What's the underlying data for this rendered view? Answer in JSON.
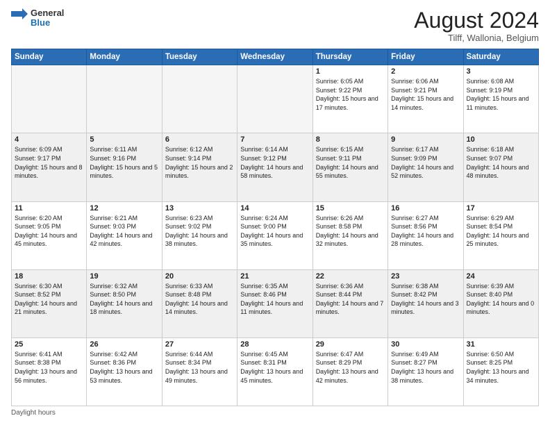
{
  "header": {
    "logo_general": "General",
    "logo_blue": "Blue",
    "month_title": "August 2024",
    "location": "Tilff, Wallonia, Belgium"
  },
  "days_of_week": [
    "Sunday",
    "Monday",
    "Tuesday",
    "Wednesday",
    "Thursday",
    "Friday",
    "Saturday"
  ],
  "footer": {
    "daylight_label": "Daylight hours"
  },
  "weeks": [
    [
      {
        "day": "",
        "empty": true
      },
      {
        "day": "",
        "empty": true
      },
      {
        "day": "",
        "empty": true
      },
      {
        "day": "",
        "empty": true
      },
      {
        "day": "1",
        "sunrise": "6:05 AM",
        "sunset": "9:22 PM",
        "daylight": "15 hours and 17 minutes."
      },
      {
        "day": "2",
        "sunrise": "6:06 AM",
        "sunset": "9:21 PM",
        "daylight": "15 hours and 14 minutes."
      },
      {
        "day": "3",
        "sunrise": "6:08 AM",
        "sunset": "9:19 PM",
        "daylight": "15 hours and 11 minutes."
      }
    ],
    [
      {
        "day": "4",
        "sunrise": "6:09 AM",
        "sunset": "9:17 PM",
        "daylight": "15 hours and 8 minutes."
      },
      {
        "day": "5",
        "sunrise": "6:11 AM",
        "sunset": "9:16 PM",
        "daylight": "15 hours and 5 minutes."
      },
      {
        "day": "6",
        "sunrise": "6:12 AM",
        "sunset": "9:14 PM",
        "daylight": "15 hours and 2 minutes."
      },
      {
        "day": "7",
        "sunrise": "6:14 AM",
        "sunset": "9:12 PM",
        "daylight": "14 hours and 58 minutes."
      },
      {
        "day": "8",
        "sunrise": "6:15 AM",
        "sunset": "9:11 PM",
        "daylight": "14 hours and 55 minutes."
      },
      {
        "day": "9",
        "sunrise": "6:17 AM",
        "sunset": "9:09 PM",
        "daylight": "14 hours and 52 minutes."
      },
      {
        "day": "10",
        "sunrise": "6:18 AM",
        "sunset": "9:07 PM",
        "daylight": "14 hours and 48 minutes."
      }
    ],
    [
      {
        "day": "11",
        "sunrise": "6:20 AM",
        "sunset": "9:05 PM",
        "daylight": "14 hours and 45 minutes."
      },
      {
        "day": "12",
        "sunrise": "6:21 AM",
        "sunset": "9:03 PM",
        "daylight": "14 hours and 42 minutes."
      },
      {
        "day": "13",
        "sunrise": "6:23 AM",
        "sunset": "9:02 PM",
        "daylight": "14 hours and 38 minutes."
      },
      {
        "day": "14",
        "sunrise": "6:24 AM",
        "sunset": "9:00 PM",
        "daylight": "14 hours and 35 minutes."
      },
      {
        "day": "15",
        "sunrise": "6:26 AM",
        "sunset": "8:58 PM",
        "daylight": "14 hours and 32 minutes."
      },
      {
        "day": "16",
        "sunrise": "6:27 AM",
        "sunset": "8:56 PM",
        "daylight": "14 hours and 28 minutes."
      },
      {
        "day": "17",
        "sunrise": "6:29 AM",
        "sunset": "8:54 PM",
        "daylight": "14 hours and 25 minutes."
      }
    ],
    [
      {
        "day": "18",
        "sunrise": "6:30 AM",
        "sunset": "8:52 PM",
        "daylight": "14 hours and 21 minutes."
      },
      {
        "day": "19",
        "sunrise": "6:32 AM",
        "sunset": "8:50 PM",
        "daylight": "14 hours and 18 minutes."
      },
      {
        "day": "20",
        "sunrise": "6:33 AM",
        "sunset": "8:48 PM",
        "daylight": "14 hours and 14 minutes."
      },
      {
        "day": "21",
        "sunrise": "6:35 AM",
        "sunset": "8:46 PM",
        "daylight": "14 hours and 11 minutes."
      },
      {
        "day": "22",
        "sunrise": "6:36 AM",
        "sunset": "8:44 PM",
        "daylight": "14 hours and 7 minutes."
      },
      {
        "day": "23",
        "sunrise": "6:38 AM",
        "sunset": "8:42 PM",
        "daylight": "14 hours and 3 minutes."
      },
      {
        "day": "24",
        "sunrise": "6:39 AM",
        "sunset": "8:40 PM",
        "daylight": "14 hours and 0 minutes."
      }
    ],
    [
      {
        "day": "25",
        "sunrise": "6:41 AM",
        "sunset": "8:38 PM",
        "daylight": "13 hours and 56 minutes."
      },
      {
        "day": "26",
        "sunrise": "6:42 AM",
        "sunset": "8:36 PM",
        "daylight": "13 hours and 53 minutes."
      },
      {
        "day": "27",
        "sunrise": "6:44 AM",
        "sunset": "8:34 PM",
        "daylight": "13 hours and 49 minutes."
      },
      {
        "day": "28",
        "sunrise": "6:45 AM",
        "sunset": "8:31 PM",
        "daylight": "13 hours and 45 minutes."
      },
      {
        "day": "29",
        "sunrise": "6:47 AM",
        "sunset": "8:29 PM",
        "daylight": "13 hours and 42 minutes."
      },
      {
        "day": "30",
        "sunrise": "6:49 AM",
        "sunset": "8:27 PM",
        "daylight": "13 hours and 38 minutes."
      },
      {
        "day": "31",
        "sunrise": "6:50 AM",
        "sunset": "8:25 PM",
        "daylight": "13 hours and 34 minutes."
      }
    ]
  ]
}
